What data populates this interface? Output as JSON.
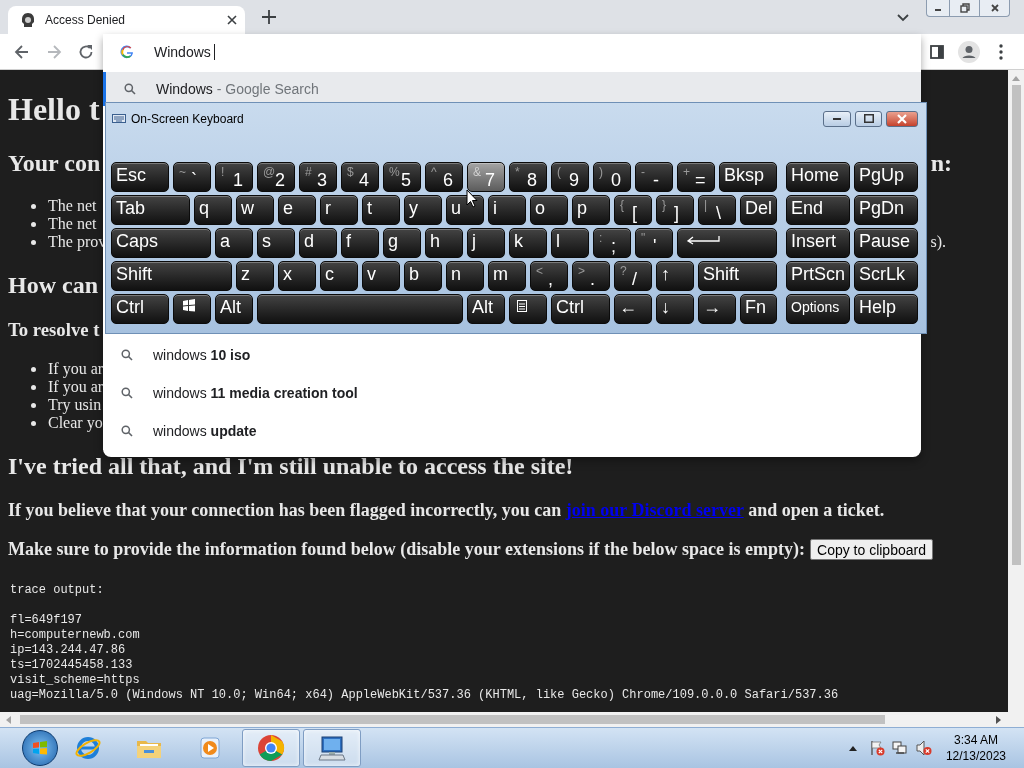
{
  "browser": {
    "tab": {
      "title": "Access Denied"
    },
    "forward_disabled": true,
    "omnibox": {
      "value": "Windows"
    },
    "suggestions_top": [
      {
        "text": "Windows",
        "hint": "- Google Search",
        "selected": true
      }
    ],
    "suggestions_bottom": [
      {
        "text": "windows **10 iso**",
        "selected": false
      },
      {
        "text": "windows **11 media creation tool**",
        "selected": false
      },
      {
        "text": "windows **update**",
        "selected": false
      }
    ]
  },
  "page": {
    "blocks": [
      {
        "kind": "h1",
        "text": "Hello t"
      },
      {
        "kind": "h2",
        "text": "Your con",
        "tail": "n:"
      },
      {
        "kind": "list",
        "items": [
          {
            "text": "The net"
          },
          {
            "text": "The net"
          },
          {
            "text": "The prov",
            "tail": "s)."
          }
        ]
      },
      {
        "kind": "h2",
        "text": "How can"
      },
      {
        "kind": "h3",
        "text": "To resolve t"
      },
      {
        "kind": "list",
        "items": [
          {
            "text": "If you ar"
          },
          {
            "text": "If you ar"
          },
          {
            "text": "Try usin"
          },
          {
            "text": "Clear yo"
          }
        ]
      },
      {
        "kind": "h2",
        "text": "I've tried all that, and I'm still unable to access the site!"
      },
      {
        "kind": "p",
        "text": "If you believe that your connection has been flagged incorrectly, you can",
        "link": "join our Discord server",
        "after": "and open a ticket."
      },
      {
        "kind": "p",
        "text": "Make sure to provide the information found below (disable your extensions if the below space is empty):",
        "button": "Copy to clipboard"
      },
      {
        "kind": "pre",
        "heading": "trace output:",
        "lines": [
          "fl=649f197",
          "h=computernewb.com",
          "ip=143.244.47.86",
          "ts=1702445458.133",
          "visit_scheme=https",
          "uag=Mozilla/5.0 (Windows NT 10.0; Win64; x64) AppleWebKit/537.36 (KHTML, like Gecko) Chrome/109.0.0.0 Safari/537.36"
        ]
      }
    ]
  },
  "keyboard": {
    "title": "On-Screen Keyboard",
    "main_rows": [
      [
        {
          "label": "Esc",
          "hover": false
        },
        {
          "shift": "~",
          "label": "`",
          "hover": false
        },
        {
          "shift": "!",
          "label": "1",
          "hover": false
        },
        {
          "shift": "@",
          "label": "2",
          "hover": false
        },
        {
          "shift": "#",
          "label": "3",
          "hover": false
        },
        {
          "shift": "$",
          "label": "4",
          "hover": false
        },
        {
          "shift": "%",
          "label": "5",
          "hover": false
        },
        {
          "shift": "^",
          "label": "6",
          "hover": false
        },
        {
          "shift": "&",
          "label": "7",
          "hover": true
        },
        {
          "shift": "*",
          "label": "8",
          "hover": false
        },
        {
          "shift": "(",
          "label": "9",
          "hover": false
        },
        {
          "shift": ")",
          "label": "0",
          "hover": false
        },
        {
          "shift": "-",
          "label": "-",
          "hover": false
        },
        {
          "shift": "+",
          "label": "=",
          "hover": false
        },
        {
          "label": "Bksp",
          "hover": false
        }
      ],
      [
        {
          "label": "Tab",
          "hover": false
        },
        {
          "label": "q",
          "hover": false
        },
        {
          "label": "w",
          "hover": false
        },
        {
          "label": "e",
          "hover": false
        },
        {
          "label": "r",
          "hover": false
        },
        {
          "label": "t",
          "hover": false
        },
        {
          "label": "y",
          "hover": false
        },
        {
          "label": "u",
          "hover": false
        },
        {
          "label": "i",
          "hover": false
        },
        {
          "label": "o",
          "hover": false
        },
        {
          "label": "p",
          "hover": false
        },
        {
          "shift": "{",
          "label": "[",
          "hover": false
        },
        {
          "shift": "}",
          "label": "]",
          "hover": false
        },
        {
          "shift": "|",
          "label": "\\",
          "hover": false
        },
        {
          "label": "Del",
          "hover": false
        }
      ],
      [
        {
          "label": "Caps",
          "hover": false
        },
        {
          "label": "a",
          "hover": false
        },
        {
          "label": "s",
          "hover": false
        },
        {
          "label": "d",
          "hover": false
        },
        {
          "label": "f",
          "hover": false
        },
        {
          "label": "g",
          "hover": false
        },
        {
          "label": "h",
          "hover": false
        },
        {
          "label": "j",
          "hover": false
        },
        {
          "label": "k",
          "hover": false
        },
        {
          "label": "l",
          "hover": false
        },
        {
          "shift": ":",
          "label": ";",
          "hover": false
        },
        {
          "shift": "\"",
          "label": "'",
          "hover": false
        },
        {
          "kind": "enter",
          "hover": false
        }
      ],
      [
        {
          "label": "Shift",
          "hover": false
        },
        {
          "label": "z",
          "hover": false
        },
        {
          "label": "x",
          "hover": false
        },
        {
          "label": "c",
          "hover": false
        },
        {
          "label": "v",
          "hover": false
        },
        {
          "label": "b",
          "hover": false
        },
        {
          "label": "n",
          "hover": false
        },
        {
          "label": "m",
          "hover": false
        },
        {
          "shift": "<",
          "label": ",",
          "hover": false
        },
        {
          "shift": ">",
          "label": ".",
          "hover": false
        },
        {
          "shift": "?",
          "label": "/",
          "hover": false
        },
        {
          "label": "↑",
          "hover": false
        },
        {
          "label": "Shift",
          "hover": false
        }
      ],
      [
        {
          "label": "Ctrl",
          "hover": false
        },
        {
          "kind": "windows",
          "hover": false
        },
        {
          "label": "Alt",
          "hover": false
        },
        {
          "kind": "space",
          "hover": false
        },
        {
          "label": "Alt",
          "hover": false
        },
        {
          "kind": "menu",
          "hover": false
        },
        {
          "label": "Ctrl",
          "hover": false
        },
        {
          "label": "←",
          "hover": false
        },
        {
          "label": "↓",
          "hover": false
        },
        {
          "label": "→",
          "hover": false
        },
        {
          "label": "Fn",
          "hover": false
        }
      ]
    ],
    "nav_rows": [
      [
        {
          "label": "Home",
          "hover": false
        },
        {
          "label": "PgUp",
          "hover": false
        }
      ],
      [
        {
          "label": "End",
          "hover": false
        },
        {
          "label": "PgDn",
          "hover": false
        }
      ],
      [
        {
          "label": "Insert",
          "hover": false
        },
        {
          "label": "Pause",
          "hover": false
        }
      ],
      [
        {
          "label": "PrtScn",
          "hover": false
        },
        {
          "label": "ScrLk",
          "hover": false
        }
      ],
      [
        {
          "label": "Options",
          "kind": "small",
          "hover": false
        },
        {
          "label": "Help",
          "hover": false
        }
      ]
    ]
  },
  "taskbar": {
    "apps": [
      {
        "kind": "ie",
        "active": false
      },
      {
        "kind": "folder",
        "active": false
      },
      {
        "kind": "media",
        "active": false
      },
      {
        "kind": "chrome",
        "active": true
      },
      {
        "kind": "osk",
        "active": true
      }
    ],
    "clock": {
      "time": "3:34 AM",
      "date": "12/13/2023"
    }
  }
}
